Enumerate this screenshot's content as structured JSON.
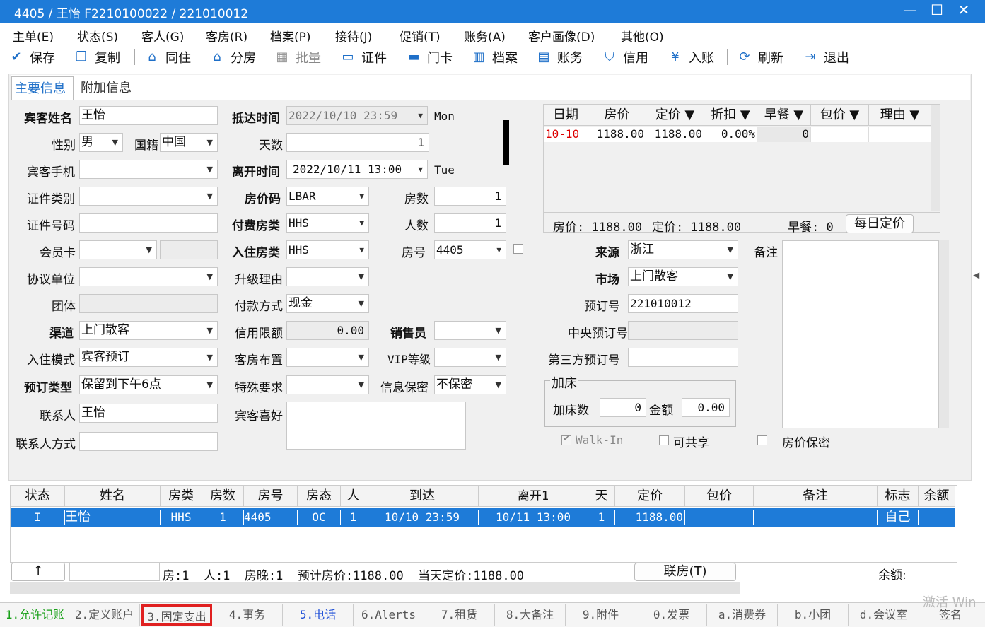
{
  "window": {
    "title": "4405 / 王怡 F2210100022 / 221010012"
  },
  "menu": [
    "主单(E)",
    "状态(S)",
    "客人(G)",
    "客房(R)",
    "档案(P)",
    "接待(J)",
    "促销(T)",
    "账务(A)",
    "客户画像(D)",
    "其他(O)"
  ],
  "toolbar": {
    "save": "保存",
    "copy": "复制",
    "share": "同住",
    "split": "分房",
    "batch": "批量",
    "cert": "证件",
    "card": "门卡",
    "profile": "档案",
    "account": "账务",
    "credit": "信用",
    "post": "入账",
    "refresh": "刷新",
    "exit": "退出"
  },
  "tabs": {
    "main": "主要信息",
    "extra": "附加信息"
  },
  "form": {
    "guest_name_label": "宾客姓名",
    "guest_name": "王怡",
    "gender_label": "性别",
    "gender": "男",
    "nation_label": "国籍",
    "nation": "中国",
    "mobile_label": "宾客手机",
    "idtype_label": "证件类别",
    "idno_label": "证件号码",
    "member_label": "会员卡",
    "company_label": "协议单位",
    "group_label": "团体",
    "channel_label": "渠道",
    "channel": "上门散客",
    "mode_label": "入住模式",
    "mode": "宾客预订",
    "restype_label": "预订类型",
    "restype": "保留到下午6点",
    "contact_label": "联系人",
    "contact": "王怡",
    "contact_way_label": "联系人方式",
    "arrive_label": "抵达时间",
    "arrive": "2022/10/10 23:59",
    "arrive_dow": "Mon",
    "days_label": "天数",
    "days": "1",
    "depart_label": "离开时间",
    "depart": "2022/10/11 13:00",
    "depart_dow": "Tue",
    "ratecode_label": "房价码",
    "ratecode": "LBAR",
    "rooms_label": "房数",
    "rooms": "1",
    "paytype_label": "付费房类",
    "paytype": "HHS",
    "persons_label": "人数",
    "persons": "1",
    "roomtype_label": "入住房类",
    "roomtype": "HHS",
    "roomno_label": "房号",
    "roomno": "4405",
    "upgrade_label": "升级理由",
    "payment_label": "付款方式",
    "payment": "现金",
    "creditlimit_label": "信用限额",
    "creditlimit": "0.00",
    "sales_label": "销售员",
    "layout_label": "客房布置",
    "vip_label": "VIP等级",
    "special_label": "特殊要求",
    "secret_label": "信息保密",
    "secret": "不保密",
    "pref_label": "宾客喜好",
    "source_label": "来源",
    "source": "浙江",
    "market_label": "市场",
    "market": "上门散客",
    "resno_label": "预订号",
    "resno": "221010012",
    "central_label": "中央预订号",
    "third_label": "第三方预订号",
    "remark_label": "备注",
    "extrabed_title": "加床",
    "extrabed_count_label": "加床数",
    "extrabed_count": "0",
    "extrabed_amount_label": "金额",
    "extrabed_amount": "0.00",
    "walkin": "Walk-In",
    "shareable": "可共享",
    "ratesecret": "房价保密"
  },
  "rate_grid": {
    "headers": [
      "日期",
      "房价",
      "定价 ▼",
      "折扣 ▼",
      "早餐 ▼",
      "包价 ▼",
      "理由 ▼"
    ],
    "row": [
      "10-10",
      "1188.00",
      "1188.00",
      "0.00%",
      "0",
      "",
      ""
    ],
    "summary_rate": "房价: 1188.00",
    "summary_fixed": "定价: 1188.00",
    "summary_bf": "早餐: 0",
    "daily_btn": "每日定价"
  },
  "room_list": {
    "headers": [
      "状态",
      "姓名",
      "房类",
      "房数",
      "房号",
      "房态",
      "人",
      "到达",
      "离开1",
      "天",
      "定价",
      "包价",
      "备注",
      "标志",
      "余额"
    ],
    "row": [
      "I",
      "王怡",
      "HHS",
      "1",
      "4405",
      "OC",
      "1",
      "10/10 23:59",
      "10/11 13:00",
      "1",
      "1188.00",
      "",
      "",
      "自己",
      ""
    ],
    "footer": {
      "up": "↑",
      "summary": "房:1  人:1  房晚:1  预计房价:1188.00  当天定价:1188.00",
      "link": "联房(T)",
      "balance": "余额:"
    }
  },
  "bottom_tabs": [
    "1.允许记账",
    "2.定义账户",
    "3.固定支出",
    "4.事务",
    "5.电话",
    "6.Alerts",
    "7.租赁",
    "8.大备注",
    "9.附件",
    "0.发票",
    "a.消费券",
    "b.小团",
    "d.会议室",
    "签名"
  ],
  "watermark": "激活 Win"
}
